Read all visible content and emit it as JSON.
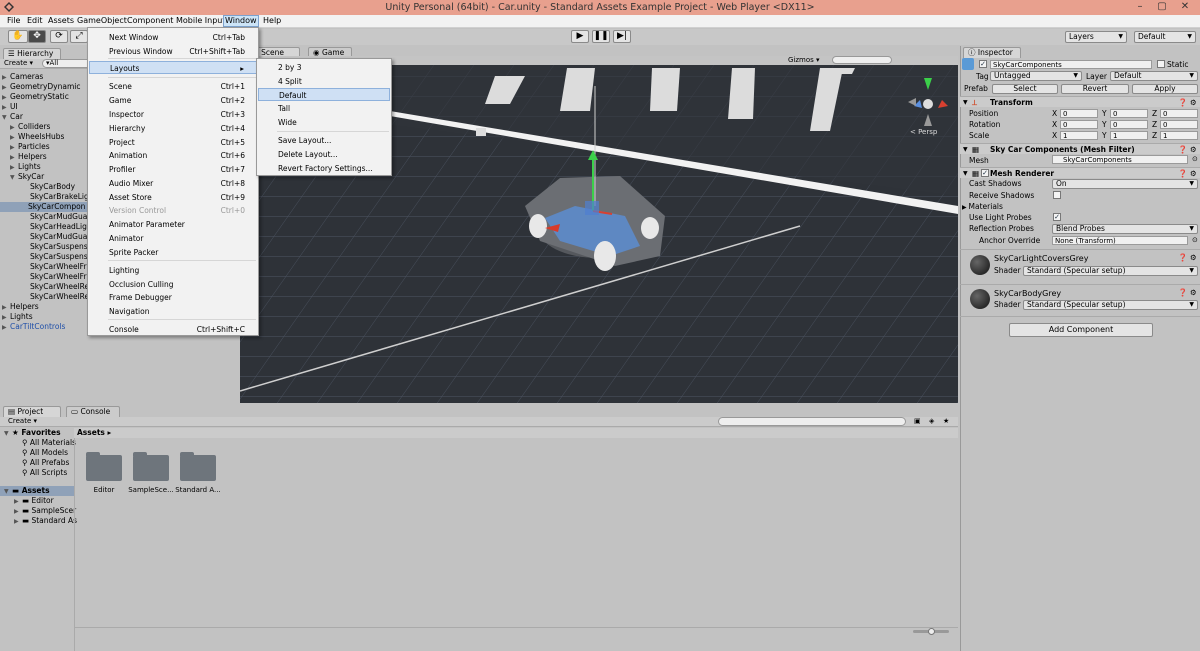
{
  "window": {
    "title": "Unity Personal (64bit) - Car.unity - Standard Assets Example Project - Web Player <DX11>",
    "min": "–",
    "max": "▢",
    "close": "✕"
  },
  "menubar": [
    "File",
    "Edit",
    "Assets",
    "GameObject",
    "Component",
    "Mobile Input",
    "Window",
    "Help"
  ],
  "toolbar": {
    "layers": "Layers",
    "layout": "Default"
  },
  "hierarchy": {
    "tab": "Hierarchy",
    "create": "Create ▾",
    "search": "▾All",
    "items": [
      "Cameras",
      "GeometryDynamic",
      "GeometryStatic",
      "UI",
      "Car",
      "Colliders",
      "WheelsHubs",
      "Particles",
      "Helpers",
      "Lights",
      "SkyCar",
      "SkyCarBody",
      "SkyCarBrakeLig",
      "SkyCarCompon",
      "SkyCarMudGua",
      "SkyCarHeadLig",
      "SkyCarMudGua",
      "SkyCarSuspens",
      "SkyCarSuspens",
      "SkyCarWheelFr",
      "SkyCarWheelFr",
      "SkyCarWheelRe",
      "SkyCarWheelRe",
      "Helpers",
      "Lights",
      "CarTiltControls"
    ]
  },
  "scene": {
    "tab_scene": "Scene",
    "tab_game": "Game",
    "gizmos": "Gizmos ▾",
    "persp": "< Persp"
  },
  "window_menu": {
    "items": [
      {
        "label": "Next Window",
        "shortcut": "Ctrl+Tab"
      },
      {
        "label": "Previous Window",
        "shortcut": "Ctrl+Shift+Tab"
      },
      {
        "label": "Layouts",
        "shortcut": "▸"
      },
      {
        "label": "Scene",
        "shortcut": "Ctrl+1"
      },
      {
        "label": "Game",
        "shortcut": "Ctrl+2"
      },
      {
        "label": "Inspector",
        "shortcut": "Ctrl+3"
      },
      {
        "label": "Hierarchy",
        "shortcut": "Ctrl+4"
      },
      {
        "label": "Project",
        "shortcut": "Ctrl+5"
      },
      {
        "label": "Animation",
        "shortcut": "Ctrl+6"
      },
      {
        "label": "Profiler",
        "shortcut": "Ctrl+7"
      },
      {
        "label": "Audio Mixer",
        "shortcut": "Ctrl+8"
      },
      {
        "label": "Asset Store",
        "shortcut": "Ctrl+9"
      },
      {
        "label": "Version Control",
        "shortcut": "Ctrl+0"
      },
      {
        "label": "Animator Parameter",
        "shortcut": ""
      },
      {
        "label": "Animator",
        "shortcut": ""
      },
      {
        "label": "Sprite Packer",
        "shortcut": ""
      },
      {
        "label": "Lighting",
        "shortcut": ""
      },
      {
        "label": "Occlusion Culling",
        "shortcut": ""
      },
      {
        "label": "Frame Debugger",
        "shortcut": ""
      },
      {
        "label": "Navigation",
        "shortcut": ""
      },
      {
        "label": "Console",
        "shortcut": "Ctrl+Shift+C"
      }
    ]
  },
  "layouts_menu": [
    "2 by 3",
    "4 Split",
    "Default",
    "Tall",
    "Wide",
    "Save Layout...",
    "Delete Layout...",
    "Revert Factory Settings..."
  ],
  "project": {
    "tab_project": "Project",
    "tab_console": "Console",
    "create": "Create ▾",
    "favorites": "Favorites",
    "fav_items": [
      "All Materials",
      "All Models",
      "All Prefabs",
      "All Scripts"
    ],
    "assets": "Assets",
    "asset_items": [
      "Editor",
      "SampleScer",
      "Standard As"
    ],
    "breadcrumb": "Assets ▸",
    "folders": [
      "Editor",
      "SampleSce...",
      "Standard A..."
    ]
  },
  "inspector": {
    "tab": "Inspector",
    "name": "SkyCarComponents",
    "static": "Static",
    "tag_label": "Tag",
    "tag": "Untagged",
    "layer_label": "Layer",
    "layer": "Default",
    "prefab": "Prefab",
    "select": "Select",
    "revert": "Revert",
    "apply": "Apply",
    "transform": "Transform",
    "position": "Position",
    "rotation": "Rotation",
    "scale": "Scale",
    "pos": [
      "0",
      "0",
      "0"
    ],
    "rot": [
      "0",
      "0",
      "0"
    ],
    "scl": [
      "1",
      "1",
      "1"
    ],
    "mesh_filter": "Sky Car Components (Mesh Filter)",
    "mesh_label": "Mesh",
    "mesh": "SkyCarComponents",
    "mesh_renderer": "Mesh Renderer",
    "cast_shadows_label": "Cast Shadows",
    "cast_shadows": "On",
    "receive_shadows": "Receive Shadows",
    "materials": "Materials",
    "use_light_probes": "Use Light Probes",
    "reflection_probes_label": "Reflection Probes",
    "reflection_probes": "Blend Probes",
    "anchor_override_label": "Anchor Override",
    "anchor_override": "None (Transform)",
    "mat1": "SkyCarLightCoversGrey",
    "mat2": "SkyCarBodyGrey",
    "shader_label": "Shader",
    "shader": "Standard (Specular setup)",
    "add_component": "Add Component"
  }
}
